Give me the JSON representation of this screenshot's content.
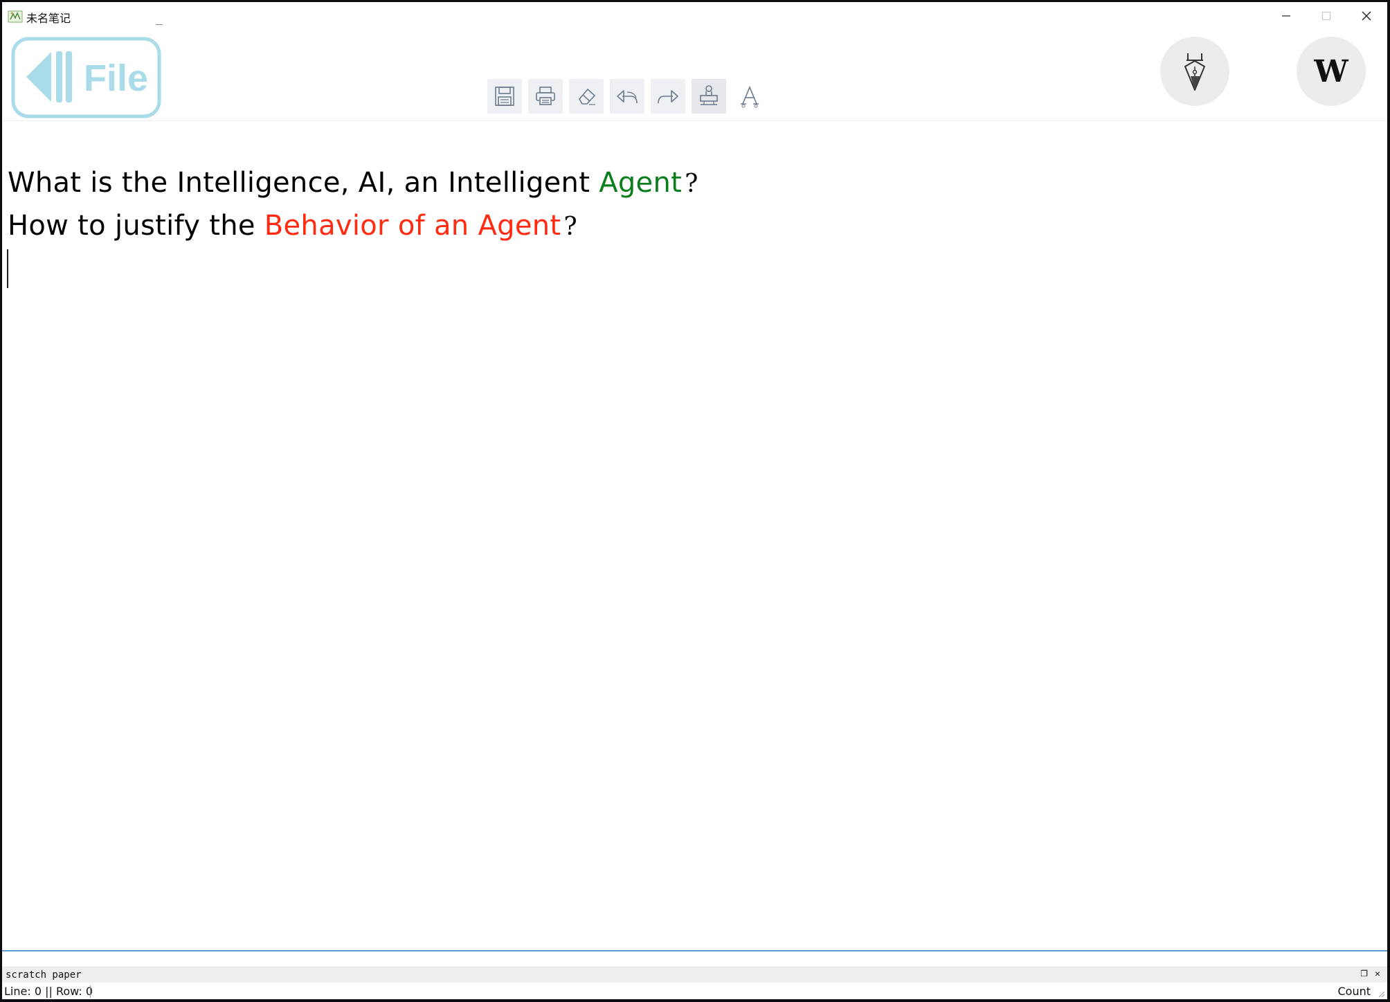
{
  "window": {
    "title": "未名笔记",
    "minimize_glyph": "—",
    "close_glyph": "✕"
  },
  "toolbar": {
    "file_label": "File",
    "tools": [
      "save",
      "print",
      "eraser",
      "undo",
      "redo",
      "stamp",
      "font"
    ]
  },
  "editor": {
    "line1": {
      "text": "What is the Intelligence, AI, an Intelligent ",
      "highlight": "Agent",
      "highlight_color": "#0a7d1c",
      "end": "?"
    },
    "line2": {
      "text": "How to justify the ",
      "highlight": "Behavior of an Agent",
      "highlight_color": "#ff2a12",
      "end": "?"
    }
  },
  "scratch": {
    "title": "scratch paper"
  },
  "status": {
    "position": "Line: 0 || Row: 0",
    "count": "Count"
  },
  "colors": {
    "file_button": "#a9dbe8",
    "panel_accent": "#5b9bd5"
  }
}
